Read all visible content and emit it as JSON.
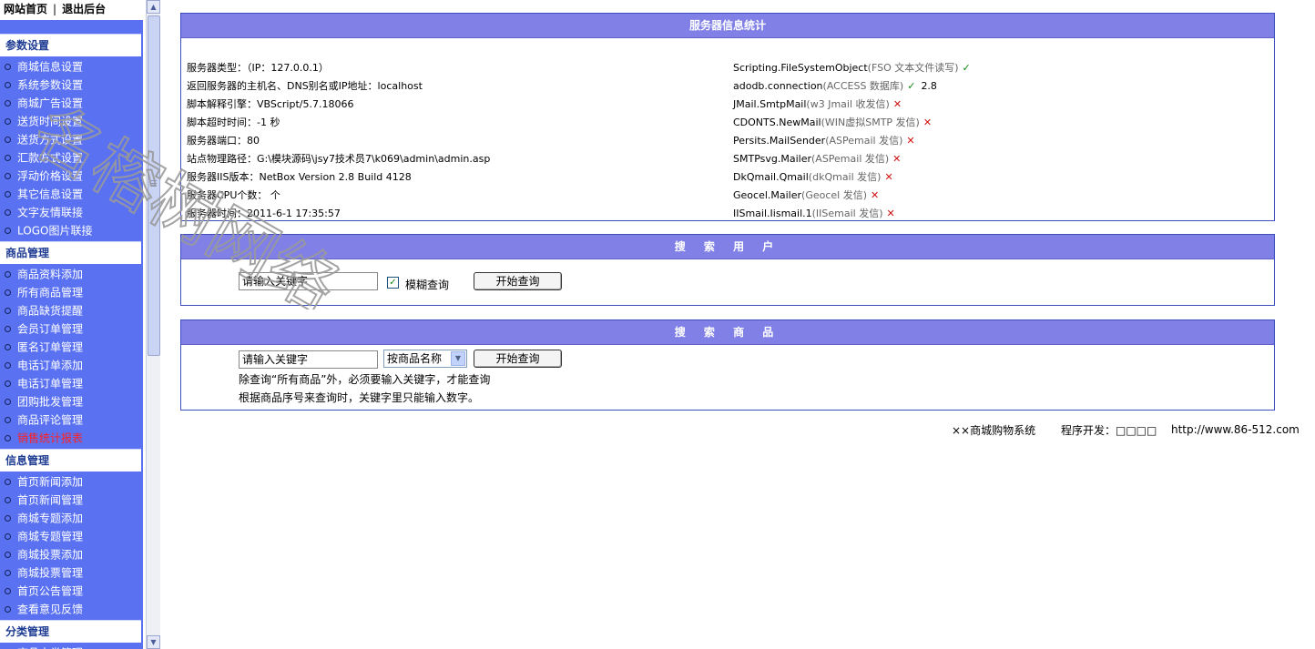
{
  "topbar": {
    "home": "网站首页",
    "separator": "|",
    "logout": "退出后台"
  },
  "sidebar": {
    "sections": [
      {
        "title": "参数设置",
        "items": [
          {
            "label": "商城信息设置"
          },
          {
            "label": "系统参数设置"
          },
          {
            "label": "商城广告设置"
          },
          {
            "label": "送货时间设置"
          },
          {
            "label": "送货方式设置"
          },
          {
            "label": "汇款方式设置"
          },
          {
            "label": "浮动价格设置"
          },
          {
            "label": "其它信息设置"
          },
          {
            "label": "文字友情联接"
          },
          {
            "label": "LOGO图片联接"
          }
        ]
      },
      {
        "title": "商品管理",
        "items": [
          {
            "label": "商品资料添加"
          },
          {
            "label": "所有商品管理"
          },
          {
            "label": "商品缺货提醒"
          },
          {
            "label": "会员订单管理"
          },
          {
            "label": "匿名订单管理"
          },
          {
            "label": "电话订单添加"
          },
          {
            "label": "电话订单管理"
          },
          {
            "label": "团购批发管理"
          },
          {
            "label": "商品评论管理"
          },
          {
            "label": "销售统计报表",
            "highlight": true
          }
        ]
      },
      {
        "title": "信息管理",
        "items": [
          {
            "label": "首页新闻添加"
          },
          {
            "label": "首页新闻管理"
          },
          {
            "label": "商城专题添加"
          },
          {
            "label": "商城专题管理"
          },
          {
            "label": "商城投票添加"
          },
          {
            "label": "商城投票管理"
          },
          {
            "label": "首页公告管理"
          },
          {
            "label": "查看意见反馈"
          }
        ]
      },
      {
        "title": "分类管理",
        "items": [
          {
            "label": "商品大类管理"
          }
        ]
      }
    ]
  },
  "server_info": {
    "title": "服务器信息统计",
    "left": [
      "服务器类型：（IP：127.0.0.1）",
      "返回服务器的主机名、DNS别名或IP地址：localhost",
      "脚本解释引擎：VBScript/5.7.18066",
      "脚本超时时间：-1 秒",
      "服务器端口：80",
      "站点物理路径：G:\\模块源码\\jsy7技术员7\\k069\\admin\\admin.asp",
      "服务器IIS版本：NetBox Version 2.8 Build 4128",
      "服务器CPU个数： 个",
      "服务器时间：2011-6-1 17:35:57"
    ],
    "right": [
      {
        "name": "Scripting.FileSystemObject",
        "desc": "(FSO 文本文件读写)",
        "status": "ok",
        "extra": ""
      },
      {
        "name": "adodb.connection",
        "desc": "(ACCESS 数据库)",
        "status": "ok",
        "extra": "2.8"
      },
      {
        "name": "JMail.SmtpMail",
        "desc": "(w3 Jmail 收发信)",
        "status": "bad",
        "extra": ""
      },
      {
        "name": "CDONTS.NewMail",
        "desc": "(WIN虚拟SMTP 发信)",
        "status": "bad",
        "extra": ""
      },
      {
        "name": "Persits.MailSender",
        "desc": "(ASPemail 发信)",
        "status": "bad",
        "extra": ""
      },
      {
        "name": "SMTPsvg.Mailer",
        "desc": "(ASPemail 发信)",
        "status": "bad",
        "extra": ""
      },
      {
        "name": "DkQmail.Qmail",
        "desc": "(dkQmail 发信)",
        "status": "bad",
        "extra": ""
      },
      {
        "name": "Geocel.Mailer",
        "desc": "(Geocel 发信)",
        "status": "bad",
        "extra": ""
      },
      {
        "name": "IISmail.Iismail.1",
        "desc": "(IISemail 发信)",
        "status": "bad",
        "extra": ""
      }
    ],
    "ok_glyph": "✓",
    "bad_glyph": "✕"
  },
  "search_user": {
    "title": "搜 索 用 户",
    "input_value": "请输入关键字",
    "fuzzy_label": "模糊查询",
    "fuzzy_checked": true,
    "button": "开始查询"
  },
  "search_goods": {
    "title": "搜 索 商 品",
    "input_value": "请输入关键字",
    "select_value": "按商品名称",
    "button": "开始查询",
    "note1": "除查询“所有商品”外，必须要输入关键字，才能查询",
    "note2": "根据商品序号来查询时，关键字里只能输入数字。"
  },
  "footer": {
    "system": "××商城购物系统",
    "dev_label": "程序开发：□□□□",
    "url": "http://www.86-512.com"
  },
  "watermark": {
    "text": "名榕树网络"
  },
  "colors": {
    "menu_blue": "#5A72F2",
    "title_purple": "#8080E6",
    "border_blue": "#3D4FBF",
    "ok_green": "#118811",
    "bad_red": "#D01010",
    "highlight_red": "#FF2020"
  }
}
